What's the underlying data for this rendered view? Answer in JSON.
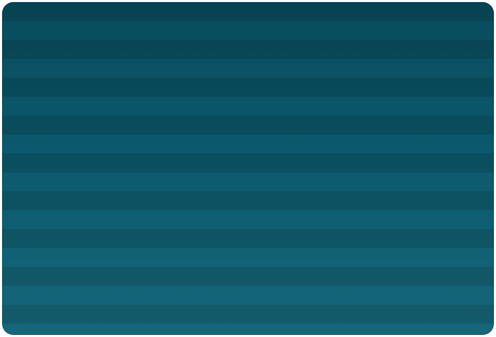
{
  "colors": {
    "stripe_dark": "#0a5566",
    "stripe_light": "#0c6175",
    "background": "#ffffff"
  }
}
